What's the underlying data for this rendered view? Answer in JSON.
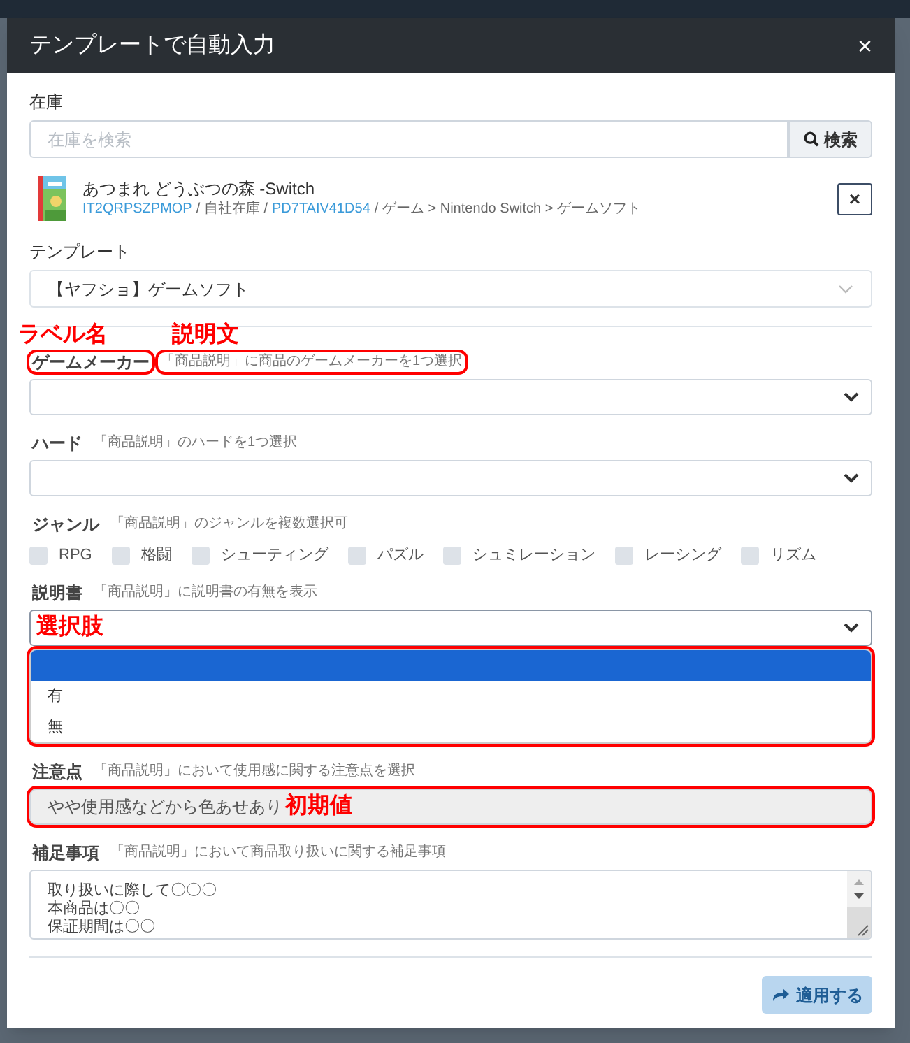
{
  "dialog": {
    "title": "テンプレートで自動入力",
    "close": "×"
  },
  "stock": {
    "label": "在庫",
    "placeholder": "在庫を検索",
    "search_button": "検索",
    "item": {
      "name": "あつまれ どうぶつの森 -Switch",
      "path": [
        {
          "kind": "link",
          "text": "IT2QRPSZPMOP"
        },
        {
          "kind": "text",
          "text": "/ 自社在庫 /"
        },
        {
          "kind": "link",
          "text": "PD7TAIV41D54"
        },
        {
          "kind": "text",
          "text": "/ ゲーム > Nintendo Switch > ゲームソフト"
        }
      ],
      "remove": "×"
    }
  },
  "template": {
    "label": "テンプレート",
    "value": "【ヤフショ】ゲームソフト"
  },
  "fields": [
    {
      "kind": "select",
      "label": "ゲームメーカー",
      "description": "「商品説明」に商品のゲームメーカーを1つ選択",
      "callouts": {
        "label": "ラベル名",
        "description": "説明文"
      }
    },
    {
      "kind": "select",
      "label": "ハード",
      "description": "「商品説明」のハードを1つ選択"
    },
    {
      "kind": "checkboxes",
      "label": "ジャンル",
      "description": "「商品説明」のジャンルを複数選択可",
      "options": [
        {
          "label": "RPG",
          "checked": false
        },
        {
          "label": "格闘",
          "checked": false
        },
        {
          "label": "シューティング",
          "checked": false
        },
        {
          "label": "パズル",
          "checked": false
        },
        {
          "label": "シュミレーション",
          "checked": false
        },
        {
          "label": "レーシング",
          "checked": false
        },
        {
          "label": "リズム",
          "checked": false
        }
      ]
    },
    {
      "kind": "select",
      "label": "説明書",
      "description": "「商品説明」に説明書の有無を表示",
      "expanded": true,
      "options": [
        {
          "selected": true
        },
        {
          "label": "有",
          "selected": false
        },
        {
          "label": "無",
          "selected": false
        }
      ],
      "callouts": {
        "options": "選択肢"
      }
    },
    {
      "kind": "text",
      "label": "注意点",
      "description": "「商品説明」において使用感に関する注意点を選択",
      "value": "やや使用感などから色あせあり",
      "callouts": {
        "value": "初期値"
      }
    },
    {
      "kind": "textarea",
      "label": "補足事項",
      "description": "「商品説明」において商品取り扱いに関する補足事項",
      "lines": [
        "取り扱いに際して〇〇〇",
        "本商品は〇〇",
        "保証期間は〇〇"
      ]
    }
  ],
  "apply_button": "適用する"
}
